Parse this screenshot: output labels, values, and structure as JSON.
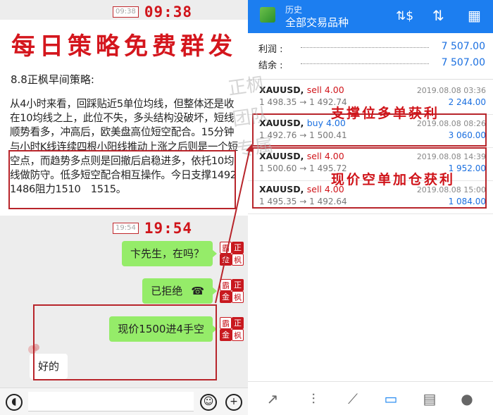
{
  "chat": {
    "top_time_small": "09:38",
    "top_time_big": "09:38",
    "headline": "每日策略免费群发",
    "strategy_title": "8.8正枫早间策略:",
    "strategy_body": "从4小时来看，回踩贴近5单位均线，但整体还是收在10均线之上，此位不失，多头结构没破坏，短线顺势看多，冲高后，欧美盘高位短空配合。15分钟与小时K线连续四根小阳线推动上涨之后则是一个短空点，而趋势多点则是回撤后启稳进多，依托10均线做防守。低多短空配合相互操作。今日支撑1492 1486阻力1510　1515。",
    "mid_time_small": "19:54",
    "mid_time_big": "19:54",
    "messages": [
      {
        "text": "卞先生，在吗？"
      },
      {
        "text": "已拒绝"
      },
      {
        "text": "现价1500进4手空"
      }
    ],
    "reply": "好的",
    "avatar_seal": [
      "霸",
      "正",
      "金",
      "枫"
    ],
    "input_icons": {
      "voice": "voice-icon",
      "emoji": "emoji-icon",
      "plus": "plus-icon"
    }
  },
  "app": {
    "title_small": "历史",
    "title_main": "全部交易品种",
    "summary": [
      {
        "label": "利润 :",
        "value": "7 507.00"
      },
      {
        "label": "结余 :",
        "value": "7 507.00"
      }
    ],
    "trades": [
      {
        "symbol": "XAUUSD,",
        "side": "sell 4.00",
        "date": "2019.08.08 03:36",
        "open": "1 498.35",
        "close": "1 492.74",
        "profit": "2 244.00"
      },
      {
        "symbol": "XAUUSD,",
        "side": "buy 4.00",
        "date": "2019.08.08 08:26",
        "open": "1 492.76",
        "close": "1 500.41",
        "profit": "3 060.00"
      },
      {
        "symbol": "XAUUSD,",
        "side": "sell 4.00",
        "date": "2019.08.08 14:39",
        "open": "1 500.60",
        "close": "1 495.72",
        "profit": "1 952.00"
      },
      {
        "symbol": "XAUUSD,",
        "side": "sell 4.00",
        "date": "2019.08.08 15:00",
        "open": "1 495.35",
        "close": "1 492.64",
        "profit": "1 084.00"
      }
    ],
    "annotation_1": "支撑位多单获利",
    "annotation_2": "现价空单加仓获利",
    "watermark": "正枫团队专属",
    "arrow_glyph": "→",
    "nav_icons": [
      "trade-icon",
      "quotes-icon",
      "chart-icon",
      "history-icon",
      "news-icon",
      "chat-icon"
    ]
  },
  "colors": {
    "accent_blue": "#1c7ef0",
    "red": "#d0141a",
    "bubble_green": "#95ec69"
  }
}
